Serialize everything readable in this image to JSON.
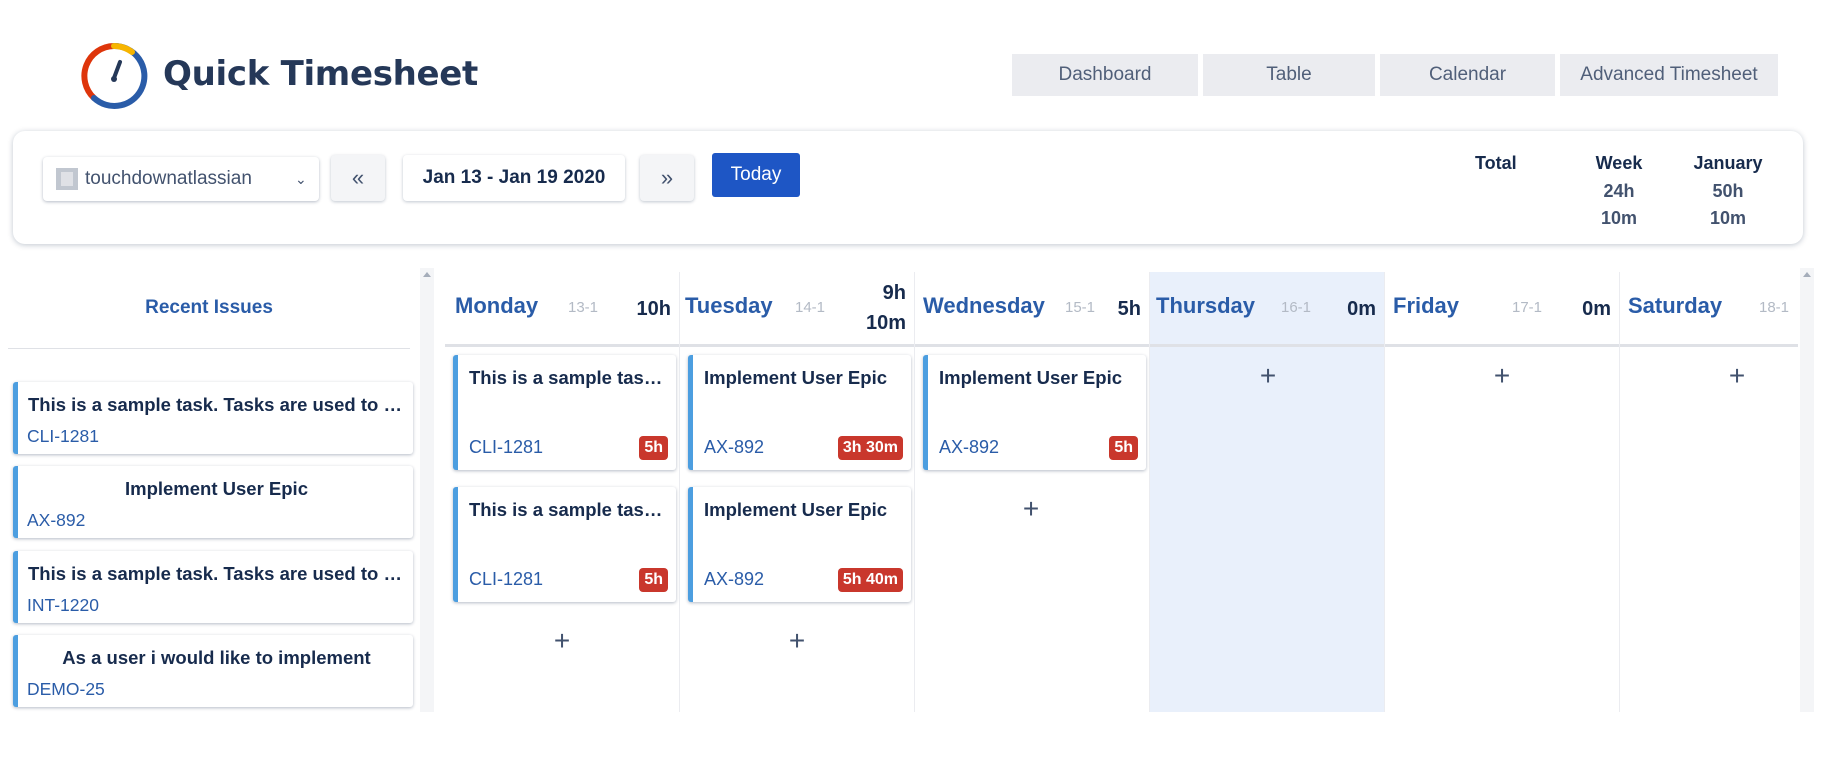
{
  "app": {
    "title": "Quick Timesheet"
  },
  "nav": {
    "tabs": [
      "Dashboard",
      "Table",
      "Calendar",
      "Advanced Timesheet"
    ]
  },
  "toolbar": {
    "user": "touchdownatlassian",
    "prev_label": "«",
    "next_label": "»",
    "date_range": "Jan 13 - Jan 19 2020",
    "today_label": "Today",
    "totals": {
      "label": "Total",
      "week_label": "Week",
      "week_hours": "24h",
      "week_minutes": "10m",
      "month_label": "January",
      "month_hours": "50h",
      "month_minutes": "10m"
    }
  },
  "sidebar": {
    "title": "Recent Issues",
    "items": [
      {
        "title": "This is a sample task. Tasks are used to break down the work",
        "key": "CLI-1281"
      },
      {
        "title": "Implement User Epic",
        "key": "AX-892"
      },
      {
        "title": "This is a sample task. Tasks are used to break down the work",
        "key": "INT-1220"
      },
      {
        "title": "As a user i would like to implement",
        "key": "DEMO-25"
      }
    ]
  },
  "calendar": {
    "add_label": "+",
    "days": [
      {
        "name": "Monday",
        "date": "13-1",
        "total": "10h",
        "total2": "",
        "entries": [
          {
            "title": "This is a sample task. Tasks are used to break down the work",
            "key": "CLI-1281",
            "time": "5h"
          },
          {
            "title": "This is a sample task. Tasks are used to break down the work",
            "key": "CLI-1281",
            "time": "5h"
          }
        ]
      },
      {
        "name": "Tuesday",
        "date": "14-1",
        "total": "9h",
        "total2": "10m",
        "entries": [
          {
            "title": "Implement User Epic",
            "key": "AX-892",
            "time": "3h 30m"
          },
          {
            "title": "Implement User Epic",
            "key": "AX-892",
            "time": "5h 40m"
          }
        ]
      },
      {
        "name": "Wednesday",
        "date": "15-1",
        "total": "5h",
        "total2": "",
        "entries": [
          {
            "title": "Implement User Epic",
            "key": "AX-892",
            "time": "5h"
          }
        ]
      },
      {
        "name": "Thursday",
        "date": "16-1",
        "total": "0m",
        "total2": "",
        "entries": []
      },
      {
        "name": "Friday",
        "date": "17-1",
        "total": "0m",
        "total2": "",
        "entries": []
      },
      {
        "name": "Saturday",
        "date": "18-1",
        "total": "",
        "total2": "",
        "entries": []
      }
    ]
  }
}
